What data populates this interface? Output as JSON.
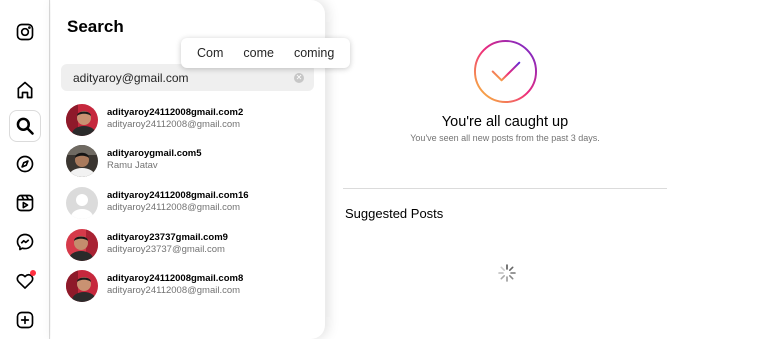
{
  "rail": {
    "items": [
      {
        "name": "instagram-icon"
      },
      {
        "name": "home-icon"
      },
      {
        "name": "search-icon",
        "active": true
      },
      {
        "name": "explore-icon"
      },
      {
        "name": "reels-icon"
      },
      {
        "name": "messenger-icon"
      },
      {
        "name": "notifications-heart-icon",
        "badge": true
      },
      {
        "name": "create-plus-icon"
      }
    ]
  },
  "search": {
    "title": "Search",
    "query": "adityaroy@gmail.com",
    "clear_icon": "clear-icon",
    "autocomplete": [
      "Com",
      "come",
      "coming"
    ],
    "results": [
      {
        "username": "adityaroy24112008gmail.com2",
        "subtitle": "adityaroy24112008@gmail.com",
        "avatar": "photo-red"
      },
      {
        "username": "adityaroygmail.com5",
        "subtitle": "Ramu Jatav",
        "avatar": "photo-dark"
      },
      {
        "username": "adityaroy24112008gmail.com16",
        "subtitle": "adityaroy24112008@gmail.com",
        "avatar": "default"
      },
      {
        "username": "adityaroy23737gmail.com9",
        "subtitle": "adityaroy23737@gmail.com",
        "avatar": "photo-red"
      },
      {
        "username": "adityaroy24112008gmail.com8",
        "subtitle": "adityaroy24112008@gmail.com",
        "avatar": "photo-red"
      }
    ]
  },
  "feed": {
    "caught_up_title": "You're all caught up",
    "caught_up_subtitle": "You've seen all new posts from the past 3 days.",
    "suggested_heading": "Suggested Posts",
    "loading_icon": "loading-spinner-icon"
  },
  "colors": {
    "notification_dot": "#ff3040",
    "gradient_start": "#f9ce34",
    "gradient_mid": "#ee2a7b",
    "gradient_end": "#6228d7",
    "secondary_text": "#737373"
  }
}
